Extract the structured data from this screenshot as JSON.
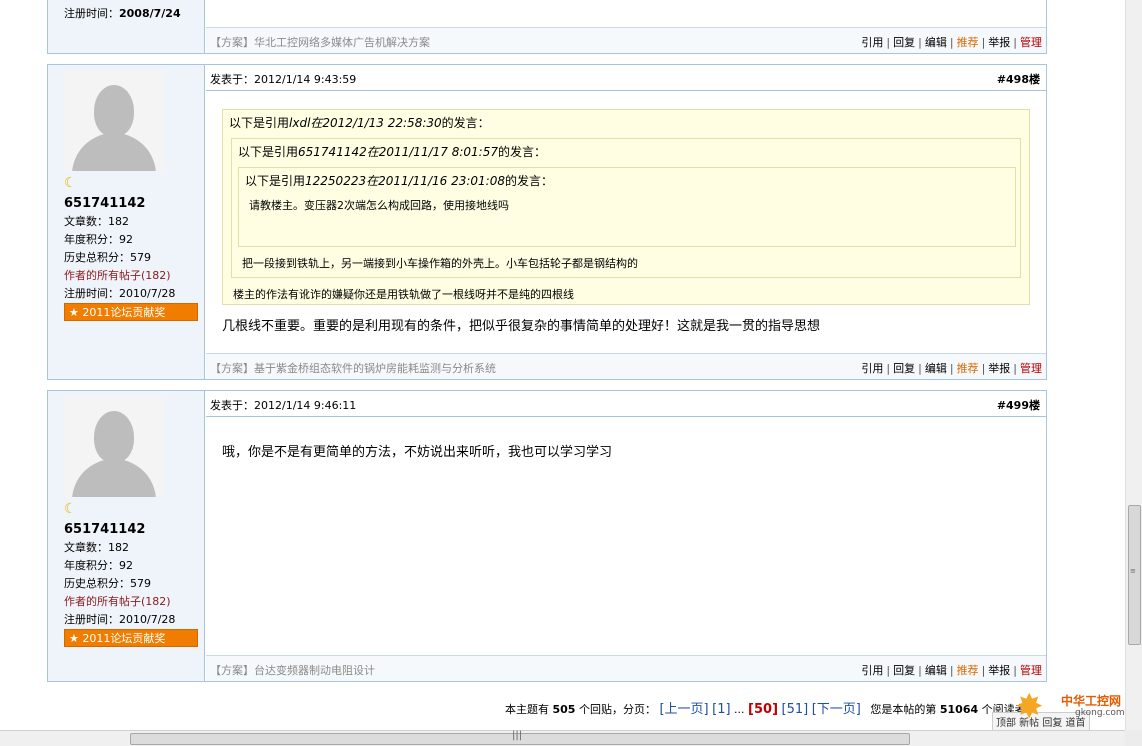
{
  "top_post": {
    "reg_label": "注册时间：",
    "reg_date": "2008/7/24",
    "signature": "【方案】华北工控网络多媒体广告机解决方案"
  },
  "actions": {
    "quote": "引用",
    "reply": "回复",
    "edit": "编辑",
    "recommend": "推荐",
    "report": "举报",
    "manage": "管理",
    "sep": "|"
  },
  "post498": {
    "posted": "发表于：2012/1/14 9:43:59",
    "floor": "#498楼",
    "user": {
      "name": "651741142",
      "articles": "文章数：182",
      "annual": "年度积分：92",
      "history": "历史总积分：579",
      "allposts": "作者的所有帖子(182)",
      "reg": "注册时间：2010/7/28",
      "badge": "★ 2011论坛贡献奖"
    },
    "q1_head_pre": "以下是引用",
    "q1_head_ref": "lxdl在2012/1/13 22:58:30",
    "q1_head_post": "的发言：",
    "q2_head_pre": "以下是引用",
    "q2_head_ref": "651741142在2011/11/17 8:01:57",
    "q2_head_post": "的发言：",
    "q3_head_pre": "以下是引用",
    "q3_head_ref": "12250223在2011/11/16 23:01:08",
    "q3_head_post": "的发言：",
    "q3_text": "请教楼主。变压器2次端怎么构成回路，使用接地线吗",
    "q2_text": "把一段接到铁轨上，另一端接到小车操作箱的外壳上。小车包括轮子都是钢结构的",
    "q1_text": "楼主的作法有讹诈的嫌疑你还是用铁轨做了一根线呀并不是纯的四根线",
    "body": "几根线不重要。重要的是利用现有的条件，把似乎很复杂的事情简单的处理好！这就是我一贯的指导思想",
    "signature": "【方案】基于紫金桥组态软件的锅炉房能耗监测与分析系统"
  },
  "post499": {
    "posted": "发表于：2012/1/14 9:46:11",
    "floor": "#499楼",
    "user": {
      "name": "651741142",
      "articles": "文章数：182",
      "annual": "年度积分：92",
      "history": "历史总积分：579",
      "allposts": "作者的所有帖子(182)",
      "reg": "注册时间：2010/7/28",
      "badge": "★ 2011论坛贡献奖"
    },
    "body": "哦，你是不是有更简单的方法，不妨说出来听听，我也可以学习学习",
    "signature": "【方案】台达变频器制动电阻设计"
  },
  "pager": {
    "prefix": "本主题有",
    "count": "505",
    "mid": "个回贴，分页：",
    "prev": "[上一页]",
    "p1": "[1]",
    "ellipsis": "...",
    "current": "[50]",
    "p51": "[51]",
    "next": "[下一页]",
    "visitor_pre": "您是本帖的第",
    "visitor_num": "51064",
    "visitor_post": "个阅读者"
  },
  "float_buttons": "顶部 新帖 回复 道首",
  "watermark": {
    "title": "中华工控网",
    "url": "gkong.com"
  }
}
